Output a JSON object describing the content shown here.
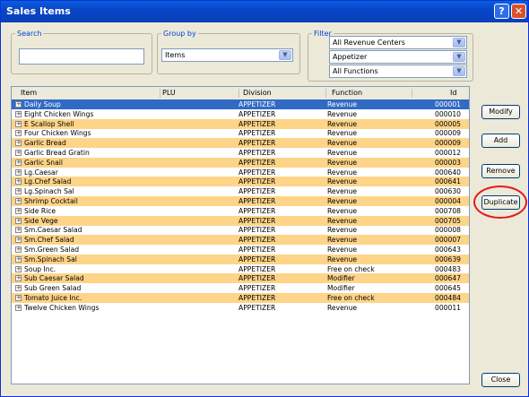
{
  "window": {
    "title": "Sales Items"
  },
  "search": {
    "label": "Search",
    "value": ""
  },
  "groupby": {
    "label": "Group by",
    "value": "Items"
  },
  "filter": {
    "label": "Filter",
    "values": [
      "All Revenue Centers",
      "Appetizer",
      "All Functions"
    ]
  },
  "table": {
    "headers": [
      "Item",
      "PLU",
      "Division",
      "Function",
      "Id"
    ],
    "rows": [
      {
        "item": "Daily Soup",
        "division": "APPETIZER",
        "function": "Revenue",
        "id": "000001",
        "selected": true
      },
      {
        "item": "Eight Chicken Wings",
        "division": "APPETIZER",
        "function": "Revenue",
        "id": "000010",
        "selected": false
      },
      {
        "item": "E Scallop Shell",
        "division": "APPETIZER",
        "function": "Revenue",
        "id": "000005",
        "selected": false
      },
      {
        "item": "Four Chicken Wings",
        "division": "APPETIZER",
        "function": "Revenue",
        "id": "000009",
        "selected": false
      },
      {
        "item": "Garlic Bread",
        "division": "APPETIZER",
        "function": "Revenue",
        "id": "000009",
        "selected": false
      },
      {
        "item": "Garlic Bread Gratin",
        "division": "APPETIZER",
        "function": "Revenue",
        "id": "000012",
        "selected": false
      },
      {
        "item": "Garlic Snail",
        "division": "APPETIZER",
        "function": "Revenue",
        "id": "000003",
        "selected": false
      },
      {
        "item": "Lg.Caesar",
        "division": "APPETIZER",
        "function": "Revenue",
        "id": "000640",
        "selected": false
      },
      {
        "item": "Lg.Chef Salad",
        "division": "APPETIZER",
        "function": "Revenue",
        "id": "000641",
        "selected": false
      },
      {
        "item": "Lg.Spinach Sal",
        "division": "APPETIZER",
        "function": "Revenue",
        "id": "000630",
        "selected": false
      },
      {
        "item": "Shrimp Cocktail",
        "division": "APPETIZER",
        "function": "Revenue",
        "id": "000004",
        "selected": false
      },
      {
        "item": "Side Rice",
        "division": "APPETIZER",
        "function": "Revenue",
        "id": "000708",
        "selected": false
      },
      {
        "item": "Side Vege",
        "division": "APPETIZER",
        "function": "Revenue",
        "id": "000705",
        "selected": false
      },
      {
        "item": "Sm.Caesar Salad",
        "division": "APPETIZER",
        "function": "Revenue",
        "id": "000008",
        "selected": false
      },
      {
        "item": "Sm.Chef Salad",
        "division": "APPETIZER",
        "function": "Revenue",
        "id": "000007",
        "selected": false
      },
      {
        "item": "Sm.Green Salad",
        "division": "APPETIZER",
        "function": "Revenue",
        "id": "000643",
        "selected": false
      },
      {
        "item": "Sm.Spinach Sal",
        "division": "APPETIZER",
        "function": "Revenue",
        "id": "000639",
        "selected": false
      },
      {
        "item": "Soup Inc.",
        "division": "APPETIZER",
        "function": "Free on check",
        "id": "000483",
        "selected": false
      },
      {
        "item": "Sub Caesar Salad",
        "division": "APPETIZER",
        "function": "Modifier",
        "id": "000647",
        "selected": false
      },
      {
        "item": "Sub Green Salad",
        "division": "APPETIZER",
        "function": "Modifier",
        "id": "000645",
        "selected": false
      },
      {
        "item": "Tomato Juice Inc.",
        "division": "APPETIZER",
        "function": "Free on check",
        "id": "000484",
        "selected": false
      },
      {
        "item": "Twelve Chicken Wings",
        "division": "APPETIZER",
        "function": "Revenue",
        "id": "000011",
        "selected": false
      }
    ]
  },
  "buttons": {
    "modify": "Modify",
    "add": "Add",
    "remove": "Remove",
    "duplicate": "Duplicate",
    "close": "Close"
  },
  "colors": {
    "selected": "#316ac5",
    "stripe": "#fdd488",
    "title": "#0a5ddc",
    "highlight_circle": "#e31b1b"
  }
}
